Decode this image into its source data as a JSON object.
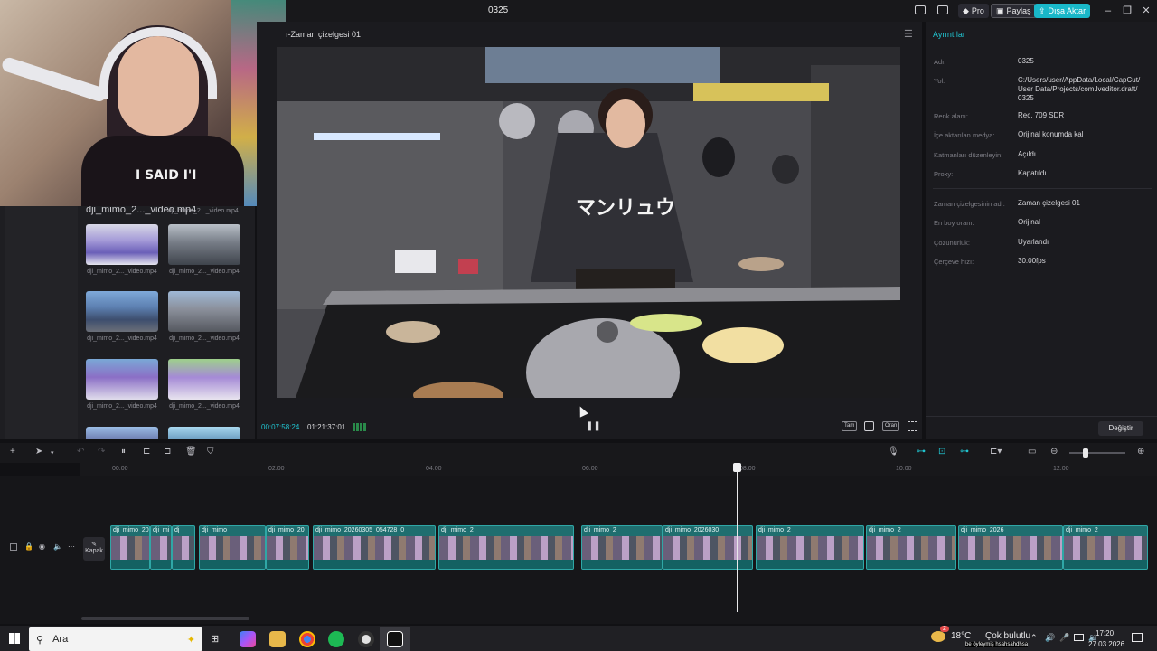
{
  "app": {
    "title": "0325",
    "pro_label": "Pro",
    "share_label": "Paylaş",
    "export_label": "Dışa Aktar"
  },
  "webcam": {
    "shirt_text": "I SAID I'I"
  },
  "media": {
    "top_labels": [
      "dji_mimo_2..._video.mp4",
      "dji_mimo_2..._video.mp4"
    ],
    "items": [
      {
        "label": "dji_mimo_2..._video.mp4"
      },
      {
        "label": "dji_mimo_2..._video.mp4"
      },
      {
        "label": "dji_mimo_2..._video.mp4"
      },
      {
        "label": "dji_mimo_2..._video.mp4"
      },
      {
        "label": "dji_mimo_2..._video.mp4"
      },
      {
        "label": "dji_mimo_2..._video.mp4"
      }
    ]
  },
  "player": {
    "title": "ı-Zaman çizelgesi 01",
    "timecode_current": "00:07:58:24",
    "timecode_total": "01:21:37:01",
    "ctrl_full": "Tam",
    "ctrl_ratio": "Oran",
    "sign_text": "マンリュウ"
  },
  "details": {
    "title": "Ayrıntılar",
    "rows": [
      {
        "label": "Adı:",
        "value": "0325"
      },
      {
        "label": "Yol:",
        "value": "C:/Users/user/AppData/Local/CapCut/ User Data/Projects/com.lveditor.draft/ 0325"
      },
      {
        "label": "Renk alanı:",
        "value": "Rec. 709 SDR"
      },
      {
        "label": "İçe aktarılan medya:",
        "value": "Orijinal konumda kal"
      },
      {
        "label": "Katmanları düzenleyin:",
        "value": "Açıldı"
      },
      {
        "label": "Proxy:",
        "value": "Kapatıldı"
      },
      {
        "label": "Zaman çizelgesinin adı:",
        "value": "Zaman çizelgesi 01"
      },
      {
        "label": "En boy oranı:",
        "value": "Orijinal"
      },
      {
        "label": "Çözünürlük:",
        "value": "Uyarlandı"
      },
      {
        "label": "Çerçeve hızı:",
        "value": "30.00fps"
      }
    ],
    "change_label": "Değiştir"
  },
  "timeline": {
    "ticks": [
      "00:00",
      "02:00",
      "04:00",
      "06:00",
      "08:00",
      "10:00",
      "12:00"
    ],
    "cover_label": "Kapak",
    "clips": [
      {
        "name": "dji_mimo_20"
      },
      {
        "name": "dji_mi"
      },
      {
        "name": "dj"
      },
      {
        "name": "dji_mimo"
      },
      {
        "name": "dji_mimo_20"
      },
      {
        "name": "dji_mimo_20260305_054728_0"
      },
      {
        "name": "dji_mimo_2"
      },
      {
        "name": "dji_mimo_2"
      },
      {
        "name": "dji_mimo_2026030"
      },
      {
        "name": "dji_mimo_2"
      },
      {
        "name": "dji_mimo_2"
      },
      {
        "name": "dji_mimo_2026"
      },
      {
        "name": "dji_mimo_2"
      }
    ]
  },
  "taskbar": {
    "search_placeholder": "Ara",
    "weather_temp": "18°C",
    "weather_desc": "Çok bulutlu",
    "notification": "be öyleymiş hsahsahdhsa",
    "time": "17:20",
    "date": "27.03.2026",
    "notification_count": "2"
  },
  "colors": {
    "accent": "#19b8c9",
    "clip": "#1f6e6f",
    "playhead": "#e8e8ea"
  }
}
